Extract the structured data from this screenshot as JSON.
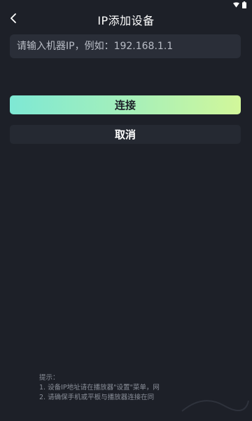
{
  "colors": {
    "background": "#1d2028",
    "input_bg": "#2a2e38",
    "cancel_bg": "#252932",
    "accent_start": "#7ee8d4",
    "accent_end": "#d2f79a"
  },
  "header": {
    "title": "IP添加设备",
    "back_icon": "chevron-left-icon"
  },
  "status": {
    "icons": [
      "wifi-icon",
      "battery-icon"
    ]
  },
  "form": {
    "ip_placeholder": "请输入机器IP，例如：192.168.1.1",
    "ip_value": ""
  },
  "actions": {
    "connect_label": "连接",
    "cancel_label": "取消"
  },
  "tips": {
    "heading": "提示：",
    "line1": "1. 设备IP地址请在播放器\"设置\"菜单，网",
    "line2": "2. 请确保手机或平板与播放器连接在同"
  }
}
